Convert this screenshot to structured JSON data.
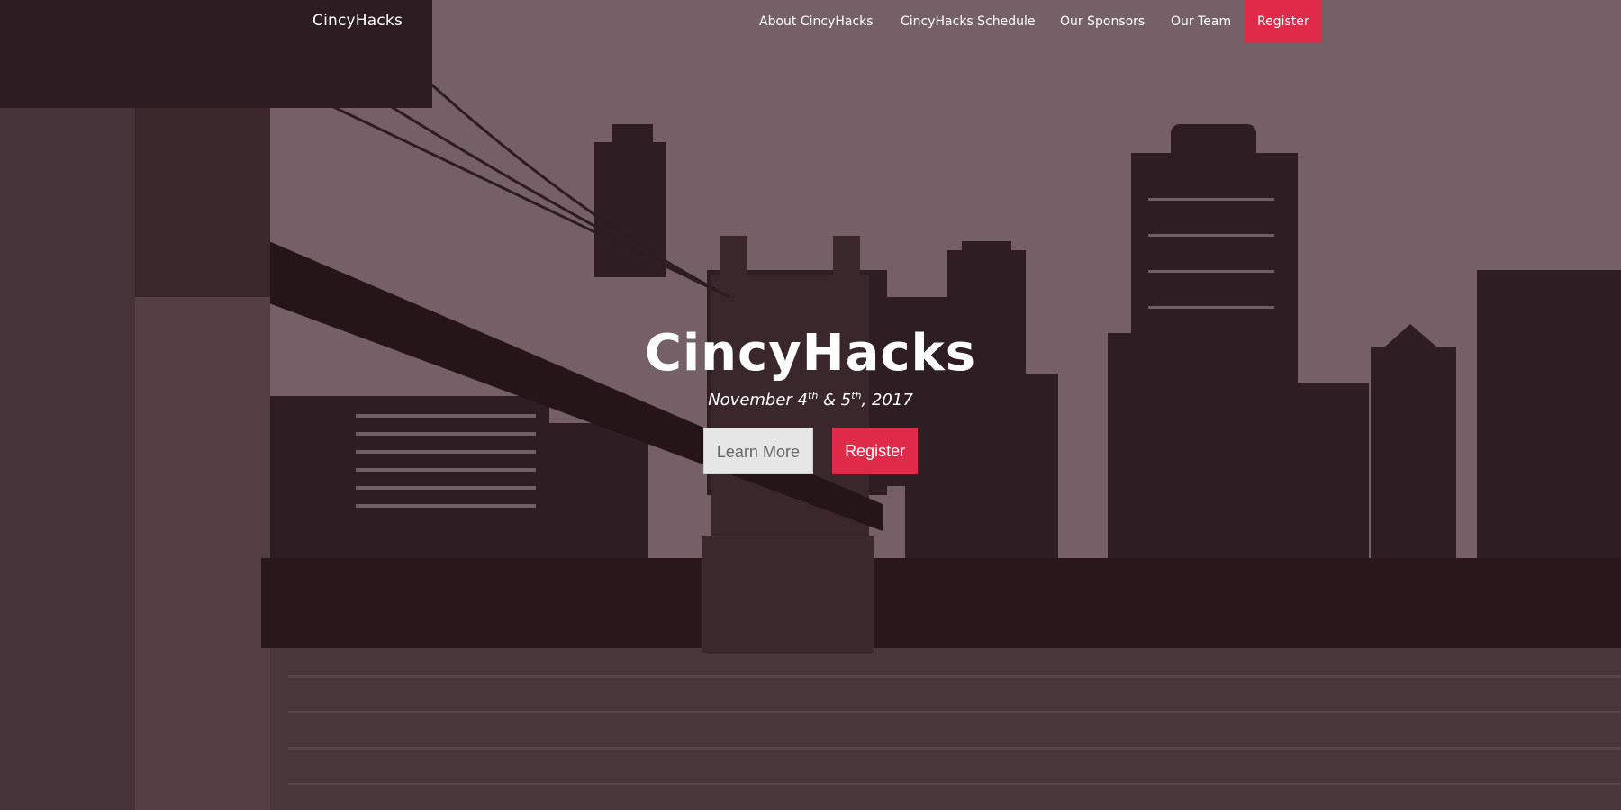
{
  "navbar": {
    "brand": "CincyHacks",
    "links": [
      {
        "label": "About CincyHacks"
      },
      {
        "label": "CincyHacks Schedule"
      },
      {
        "label": "Our Sponsors"
      },
      {
        "label": "Our Team"
      }
    ],
    "register_label": "Register"
  },
  "hero": {
    "title": "CincyHacks",
    "date": {
      "month": "November 4",
      "sup1": "th",
      "amp": " & 5",
      "sup2": "th",
      "year": ", 2017"
    },
    "learn_more_label": "Learn More",
    "register_label": "Register"
  },
  "colors": {
    "accent": "#e02a4a",
    "overlay": "#3a2a2e",
    "learn_bg": "#e6e6e6"
  }
}
